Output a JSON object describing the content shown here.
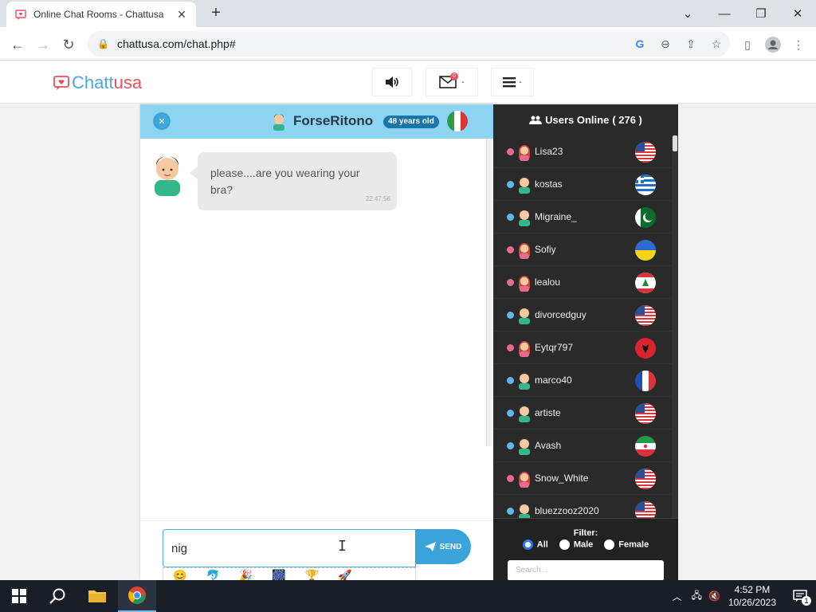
{
  "browser": {
    "tab_title": "Online Chat Rooms - Chattusa",
    "url": "chattusa.com/chat.php#"
  },
  "site": {
    "logo_part1": "Chatt",
    "logo_part2": "usa",
    "mail_count": "0",
    "caret": "-"
  },
  "chat": {
    "peer_name": "ForseRitono",
    "peer_age": "48 years old",
    "close_label": "×",
    "messages": [
      {
        "text": "please....are you wearing your bra?",
        "time": "22:47:56"
      }
    ],
    "input_value": "nig",
    "send_label": "SEND"
  },
  "users": {
    "title": "Users Online",
    "count": "( 276 )",
    "list": [
      {
        "name": "Lisa23",
        "gender": "female",
        "flag": "us"
      },
      {
        "name": "kostas",
        "gender": "male",
        "flag": "gr"
      },
      {
        "name": "Migraine_",
        "gender": "male",
        "flag": "pk"
      },
      {
        "name": "Sofiy",
        "gender": "female",
        "flag": "ua"
      },
      {
        "name": "lealou",
        "gender": "female",
        "flag": "lb"
      },
      {
        "name": "divorcedguy",
        "gender": "male",
        "flag": "us"
      },
      {
        "name": "Eytqr797",
        "gender": "female",
        "flag": "al"
      },
      {
        "name": "marco40",
        "gender": "male",
        "flag": "fr"
      },
      {
        "name": "artiste",
        "gender": "male",
        "flag": "us"
      },
      {
        "name": "Avash",
        "gender": "male",
        "flag": "ir"
      },
      {
        "name": "Snow_White",
        "gender": "female",
        "flag": "us"
      },
      {
        "name": "bluezzooz2020",
        "gender": "male",
        "flag": "us"
      }
    ],
    "filter_title": "Filter:",
    "filter_all": "All",
    "filter_male": "Male",
    "filter_female": "Female",
    "search_placeholder": "Search..."
  },
  "taskbar": {
    "time": "4:52 PM",
    "date": "10/26/2023",
    "notif_count": "1"
  },
  "colors": {
    "brand_blue": "#4aa7e6",
    "brand_red": "#e8505b",
    "female_dot": "#e86a8f",
    "male_dot": "#5fb7ea"
  }
}
